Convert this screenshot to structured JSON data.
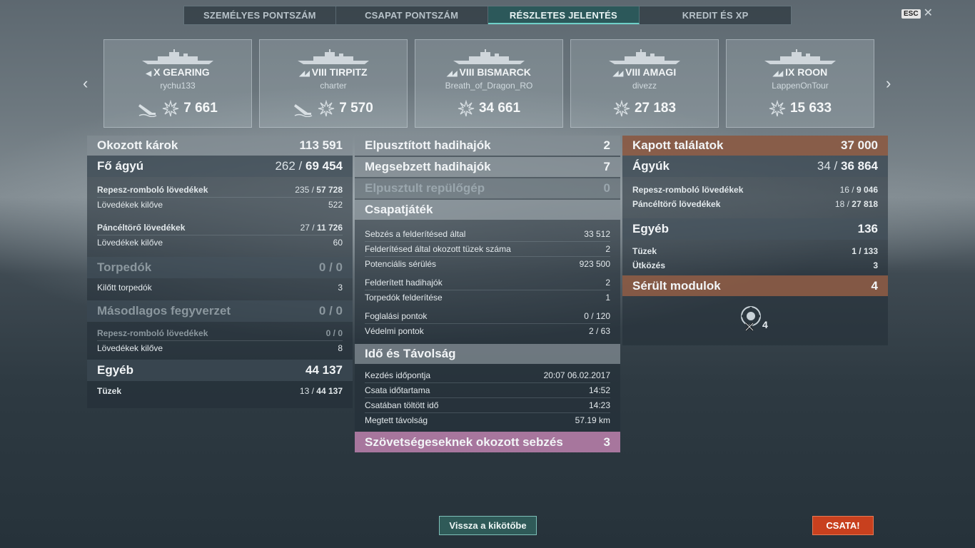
{
  "tabs": [
    {
      "label": "SZEMÉLYES PONTSZÁM",
      "active": false
    },
    {
      "label": "CSAPAT PONTSZÁM",
      "active": false
    },
    {
      "label": "RÉSZLETES JELENTÉS",
      "active": true
    },
    {
      "label": "KREDIT ÉS XP",
      "active": false
    }
  ],
  "esc": {
    "key": "ESC",
    "close": "✕"
  },
  "nav": {
    "prev": "‹",
    "next": "›"
  },
  "ships": [
    {
      "tier_class": "◀",
      "name": "X GEARING",
      "player": "rychu133",
      "sunk_icon": true,
      "score": "7 661"
    },
    {
      "tier_class": "◢◢",
      "name": "VIII TIRPITZ",
      "player": "charter",
      "sunk_icon": true,
      "score": "7 570"
    },
    {
      "tier_class": "◢◢",
      "name": "VIII BISMARCK",
      "player": "Breath_of_Dragon_RO",
      "sunk_icon": false,
      "score": "34 661"
    },
    {
      "tier_class": "◢◢",
      "name": "VIII AMAGI",
      "player": "divezz",
      "sunk_icon": false,
      "score": "27 183"
    },
    {
      "tier_class": "◢◢",
      "name": "IX ROON",
      "player": "LappenOnTour",
      "sunk_icon": false,
      "score": "15 633"
    }
  ],
  "left": {
    "damage": {
      "label": "Okozott károk",
      "value": "113 591"
    },
    "main": {
      "label": "Fő ágyú",
      "hits": "262",
      "dmg": "69 454"
    },
    "he": {
      "label": "Repesz-romboló lövedékek",
      "hits": "235",
      "dmg": "57 728"
    },
    "he_fired": {
      "label": "Lövedékek kilőve",
      "value": "522"
    },
    "ap": {
      "label": "Páncéltörő lövedékek",
      "hits": "27",
      "dmg": "11 726"
    },
    "ap_fired": {
      "label": "Lövedékek kilőve",
      "value": "60"
    },
    "torp": {
      "label": "Torpedók",
      "value": "0 / 0"
    },
    "torp_fired": {
      "label": "Kilőtt torpedók",
      "value": "3"
    },
    "secondary": {
      "label": "Másodlagos fegyverzet",
      "value": "0 / 0"
    },
    "sec_he": {
      "label": "Repesz-romboló lövedékek",
      "value": "0 / 0"
    },
    "sec_fired": {
      "label": "Lövedékek kilőve",
      "value": "8"
    },
    "other": {
      "label": "Egyéb",
      "value": "44 137"
    },
    "fires": {
      "label": "Tüzek",
      "hits": "13",
      "dmg": "44 137"
    }
  },
  "middle": {
    "destroyed": {
      "label": "Elpusztított hadihajók",
      "value": "2"
    },
    "damaged": {
      "label": "Megsebzett hadihajók",
      "value": "7"
    },
    "planes": {
      "label": "Elpusztult repülőgép",
      "value": "0"
    },
    "team": {
      "label": "Csapatjáték"
    },
    "team_rows": [
      {
        "label": "Sebzés a felderítésed által",
        "value": "33 512"
      },
      {
        "label": "Felderítésed által okozott tüzek száma",
        "value": "2"
      },
      {
        "label": "Potenciális sérülés",
        "value": "923 500"
      },
      {
        "label": "Felderített hadihajók",
        "value": "2"
      },
      {
        "label": "Torpedók felderítése",
        "value": "1"
      },
      {
        "label": "Foglalási pontok",
        "value": "0 / 120"
      },
      {
        "label": "Védelmi pontok",
        "value": "2 / 63"
      }
    ],
    "time": {
      "label": "Idő és Távolság"
    },
    "time_rows": [
      {
        "label": "Kezdés időpontja",
        "value": "20:07  06.02.2017"
      },
      {
        "label": "Csata időtartama",
        "value": "14:52"
      },
      {
        "label": "Csatában töltött idő",
        "value": "14:23"
      },
      {
        "label": "Megtett távolság",
        "value": "57.19 km"
      }
    ],
    "ally": {
      "label": "Szövetségeseknek okozott sebzés",
      "value": "3"
    }
  },
  "right": {
    "received": {
      "label": "Kapott találatok",
      "value": "37 000"
    },
    "guns": {
      "label": "Ágyúk",
      "hits": "34",
      "dmg": "36 864"
    },
    "he": {
      "label": "Repesz-romboló lövedékek",
      "hits": "16",
      "dmg": "9 046"
    },
    "ap": {
      "label": "Páncéltörő lövedékek",
      "hits": "18",
      "dmg": "27 818"
    },
    "other": {
      "label": "Egyéb",
      "value": "136"
    },
    "fires": {
      "label": "Tüzek",
      "value": "1 / 133"
    },
    "collision": {
      "label": "Ütközés",
      "value": "3"
    },
    "modules": {
      "label": "Sérült modulok",
      "value": "4"
    },
    "module_count": "4"
  },
  "buttons": {
    "back": "Vissza a kikötőbe",
    "battle": "CSATA!"
  }
}
